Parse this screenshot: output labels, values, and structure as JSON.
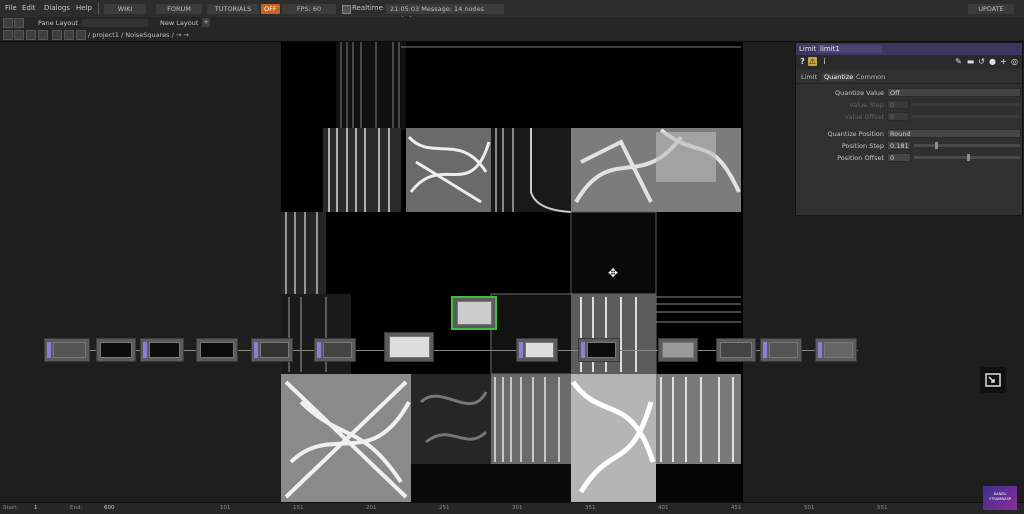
{
  "menu": {
    "file": "File",
    "edit": "Edit",
    "dialogs": "Dialogs",
    "help": "Help"
  },
  "toolbar": {
    "wiki": "WIKI",
    "forum": "FORUM",
    "tutorials": "TUTORIALS",
    "badge": "OFF",
    "fps": "FPS: 60",
    "realtime": "Realtime",
    "message": "21:05:03 Message: 14 nodes copied",
    "update": "UPDATE"
  },
  "panes": {
    "pane_layout": "Pane Layout",
    "new_layout": "New Layout",
    "add": "+"
  },
  "path": {
    "text": "/ project1 / NoiseSquares / → →"
  },
  "panel": {
    "type": "Limit",
    "name": "limit1",
    "tabs": [
      "Limit",
      "Quantize",
      "Common"
    ],
    "params": [
      {
        "label": "Quantize Value",
        "value": "Off",
        "kind": "menu",
        "dim": false
      },
      {
        "label": "Value Step",
        "value": "0",
        "kind": "slider",
        "dim": true
      },
      {
        "label": "Value Offset",
        "value": "0",
        "kind": "slider",
        "dim": true
      },
      {
        "label": "Quantize Position",
        "value": "Round",
        "kind": "menu",
        "dim": false
      },
      {
        "label": "Position Step",
        "value": "0.181",
        "kind": "slider",
        "dim": false
      },
      {
        "label": "Position Offset",
        "value": "0",
        "kind": "slider",
        "dim": false
      }
    ]
  },
  "timeline": {
    "start_label": "Start:",
    "start_value": "1",
    "end_label": "End:",
    "end_value": "600",
    "ticks": [
      "101",
      "151",
      "201",
      "251",
      "301",
      "351",
      "401",
      "451",
      "501",
      "551"
    ]
  },
  "watermark": {
    "line1": "DANIEL",
    "line2": "STRAMWASP"
  },
  "colors": {
    "accent": "#8a7fd6",
    "title_bar": "#3f3660",
    "selected_node": "#3fbf3f"
  }
}
